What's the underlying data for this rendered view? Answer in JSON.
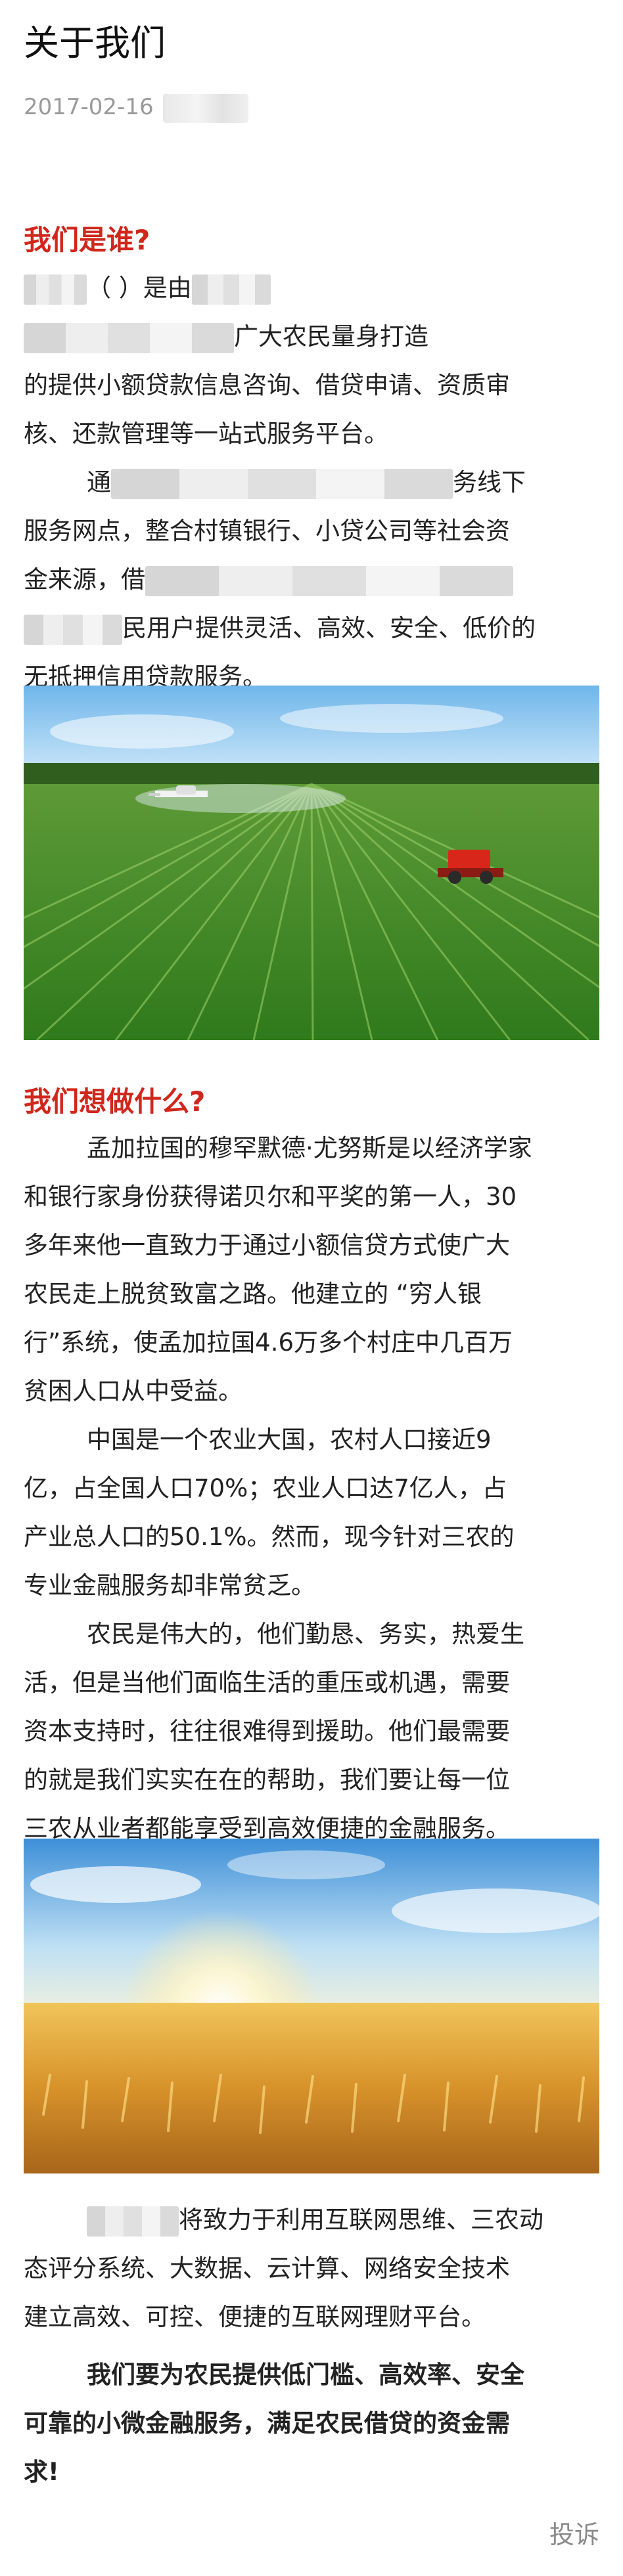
{
  "article": {
    "title": "关于我们",
    "date": "2017-02-16"
  },
  "section1": {
    "heading": "我们是谁?",
    "p1": [
      "（             ）是由",
      "广大农民量身打造",
      "的提供小额贷款信息咨询、借贷申请、资质审",
      "核、还款管理等一站式服务平台。"
    ],
    "p2": [
      "通",
      "务线下",
      "服务网点，整合村镇银行、小贷公司等社会资",
      "金来源，借",
      "民用户提供灵活、高效、安全、低价的",
      "无抵押信用贷款服务。"
    ]
  },
  "section2": {
    "heading": "我们想做什么?",
    "p1": [
      "孟加拉国的穆罕默德·尤努斯是以经济学家",
      "和银行家身份获得诺贝尔和平奖的第一人，30",
      "多年来他一直致力于通过小额信贷方式使广大",
      "农民走上脱贫致富之路。他建立的 “穷人银",
      "行”系统，使孟加拉国4.6万多个村庄中几百万",
      "贫困人口从中受益。"
    ],
    "p2": [
      "中国是一个农业大国，农村人口接近9",
      "亿，占全国人口70%；农业人口达7亿人，占",
      "产业总人口的50.1%。然而，现今针对三农的",
      "专业金融服务却非常贫乏。"
    ],
    "p3": [
      "农民是伟大的，他们勤恳、务实，热爱生",
      "活，但是当他们面临生活的重压或机遇，需要",
      "资本支持时，往往很难得到援助。他们最需要",
      "的就是我们实实在在的帮助，我们要让每一位",
      "三农从业者都能享受到高效便捷的金融服务。"
    ],
    "p4": [
      "将致力于利用互联网思维、三农动",
      "态评分系统、大数据、云计算、网络安全技术",
      "建立高效、可控、便捷的互联网理财平台。"
    ],
    "closing": [
      "我们要为农民提供低门槛、高效率、安全",
      "可靠的小微金融服务，满足农民借贷的资金需",
      "求!"
    ]
  },
  "footer": {
    "report_label": "投诉"
  },
  "colors": {
    "heading_red": "#d0271d",
    "meta_gray": "#9a9a9a"
  }
}
